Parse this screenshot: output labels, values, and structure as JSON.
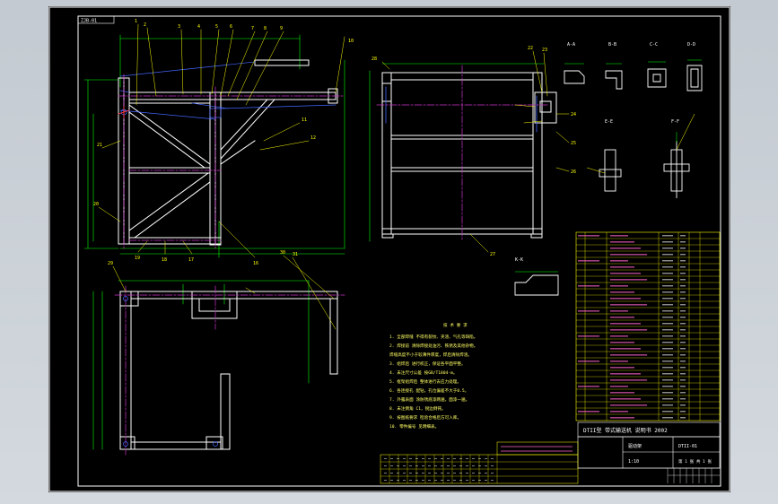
{
  "drawing": {
    "corner_tag": "ZJB-01",
    "frame_color": "#ffffff",
    "steel_color": "#ffffff",
    "centerline_color": "#cc33cc",
    "dimension_color": "#00ff00",
    "leader_color": "#ffff00",
    "blue_color": "#4466ff",
    "red_color": "#ff3333"
  },
  "sections": [
    {
      "label": "A-A"
    },
    {
      "label": "B-B"
    },
    {
      "label": "C-C"
    },
    {
      "label": "D-D"
    },
    {
      "label": "E-E"
    },
    {
      "label": "F-F"
    },
    {
      "label": "K-K"
    }
  ],
  "notes": {
    "title": "技 术 要 求",
    "lines": [
      "1. 全部焊缝 不得有裂纹、夹渣、气孔等缺陷。",
      "2. 焊接前 清除焊接处油污、铁锈及其他杂物。",
      "   焊缝高度不小于较薄件厚度，焊后清除焊渣。",
      "3. 组焊后 进行校正，保证各平面平整。",
      "4. 未注尺寸公差 按GB/T1804-m。",
      "5. 框架组焊后 整体进行去应力处理。",
      "6. 各连接孔 配钻，孔位偏差不大于0.5。",
      "7. 外露表面 涂防锈底漆两遍，面漆一遍。",
      "8. 未注倒角 C1，锐边倒钝。",
      "9. 按图纸要求 检验合格后方可入库。",
      "10. 零件编号 见明细表。"
    ]
  },
  "title_block": {
    "project": "DTII型 带式输送机 说明书 2002",
    "name": "驱动架",
    "scale": "1:10",
    "sheet": "第 1 张 共 1 张",
    "code": "DTII-01"
  }
}
